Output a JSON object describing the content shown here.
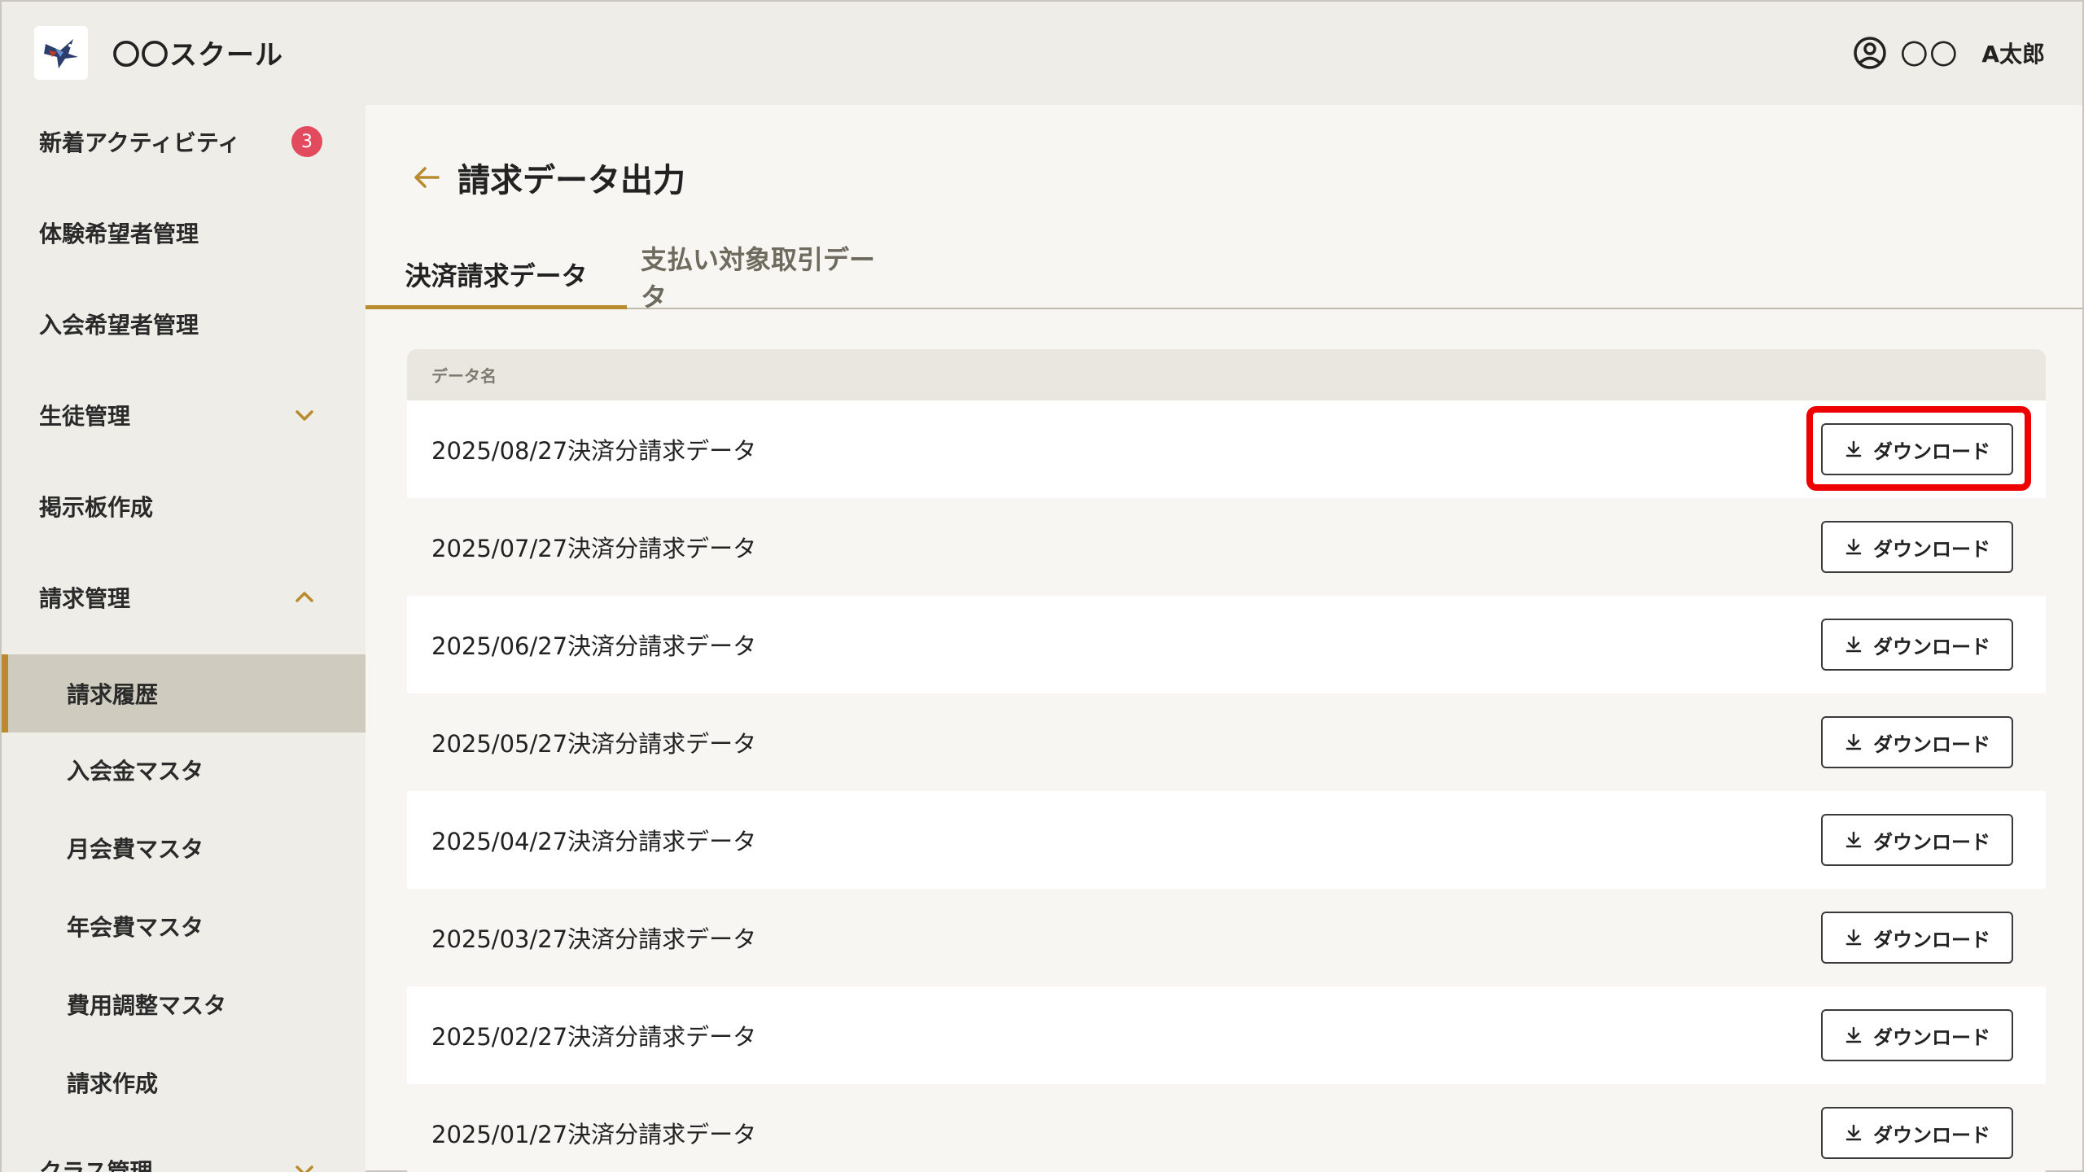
{
  "header": {
    "school_name": "〇〇スクール",
    "user_last": "〇〇",
    "user_first": "A太郎"
  },
  "sidebar": {
    "items": [
      {
        "label": "新着アクティビティ",
        "badge": "3"
      },
      {
        "label": "体験希望者管理"
      },
      {
        "label": "入会希望者管理"
      },
      {
        "label": "生徒管理",
        "chevron": "chevron-down"
      },
      {
        "label": "掲示板作成"
      },
      {
        "label": "請求管理",
        "chevron": "chevron-up"
      },
      {
        "label": "請求履歴",
        "active": true
      },
      {
        "label": "入会金マスタ"
      },
      {
        "label": "月会費マスタ"
      },
      {
        "label": "年会費マスタ"
      },
      {
        "label": "費用調整マスタ"
      },
      {
        "label": "請求作成"
      },
      {
        "label": "クラス管理",
        "chevron": "chevron-down"
      }
    ]
  },
  "main": {
    "title": "請求データ出力",
    "tabs": [
      {
        "label": "決済請求データ",
        "active": true
      },
      {
        "label": "支払い対象取引データ",
        "active": false
      }
    ],
    "table": {
      "header": "データ名",
      "button_label": "ダウンロード",
      "rows": [
        "2025/08/27決済分請求データ",
        "2025/07/27決済分請求データ",
        "2025/06/27決済分請求データ",
        "2025/05/27決済分請求データ",
        "2025/04/27決済分請求データ",
        "2025/03/27決済分請求データ",
        "2025/02/27決済分請求データ",
        "2025/01/27決済分請求データ"
      ]
    }
  },
  "colors": {
    "accent": "#b88b2e",
    "badge": "#e24a5e",
    "highlight": "#ee0000",
    "sidebar_bg": "#eeede8",
    "active_bg": "#cfccbf"
  }
}
